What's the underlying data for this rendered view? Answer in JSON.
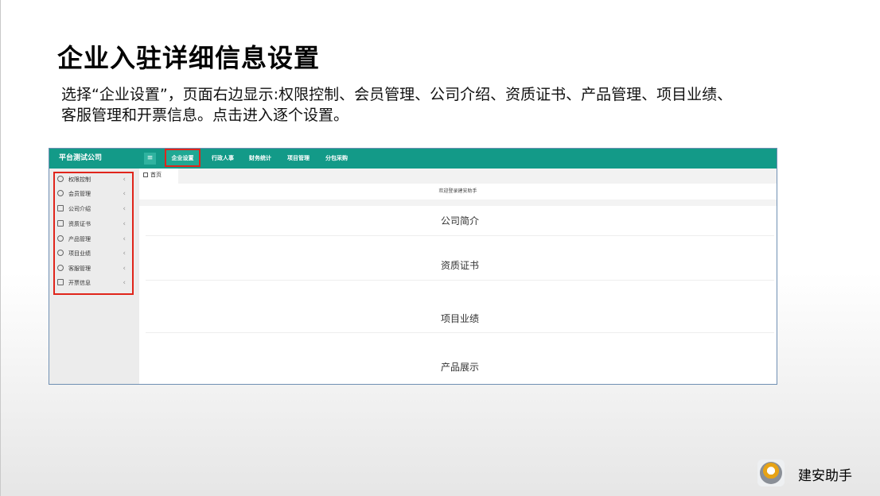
{
  "slide": {
    "title": "企业入驻详细信息设置",
    "description": "选择“企业设置”，页面右边显示:权限控制、会员管理、公司介绍、资质证书、产品管理、项目业绩、客服管理和开票信息。点击进入逐个设置。"
  },
  "app": {
    "company_name": "平台测试公司",
    "menu_icon": "hamburger-icon",
    "nav": [
      {
        "label": "企业设置",
        "active": true
      },
      {
        "label": "行政人事"
      },
      {
        "label": "财务统计"
      },
      {
        "label": "项目管理"
      },
      {
        "label": "分包采购"
      }
    ],
    "sidebar": [
      {
        "label": "权限控制",
        "icon": "settings-icon"
      },
      {
        "label": "会员管理",
        "icon": "user-circle-icon"
      },
      {
        "label": "公司介绍",
        "icon": "document-icon"
      },
      {
        "label": "资质证书",
        "icon": "image-icon"
      },
      {
        "label": "产品管理",
        "icon": "product-icon"
      },
      {
        "label": "项目业绩",
        "icon": "history-icon"
      },
      {
        "label": "客服管理",
        "icon": "person-icon"
      },
      {
        "label": "开票信息",
        "icon": "edit-icon"
      }
    ],
    "home_tab": "首页",
    "welcome": "欢迎登录建安助手",
    "sections": [
      "公司简介",
      "资质证书",
      "项目业绩",
      "产品展示"
    ],
    "colors": {
      "header": "#139a88",
      "highlight": "#e0251b"
    }
  },
  "brand": {
    "name": "建安助手"
  }
}
